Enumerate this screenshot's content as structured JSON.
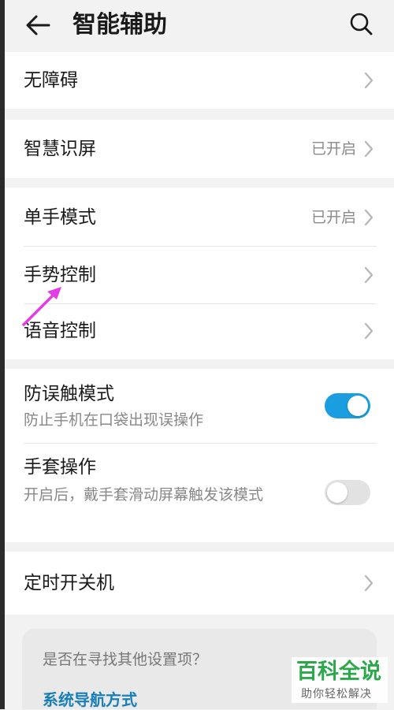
{
  "header": {
    "title": "智能辅助",
    "back_icon": "arrow-left-icon",
    "search_icon": "search-icon"
  },
  "items": {
    "accessibility": {
      "title": "无障碍"
    },
    "smart_screen": {
      "title": "智慧识屏",
      "status": "已开启"
    },
    "one_hand": {
      "title": "单手模式",
      "status": "已开启"
    },
    "gesture": {
      "title": "手势控制"
    },
    "voice": {
      "title": "语音控制"
    },
    "anti_touch": {
      "title": "防误触模式",
      "subtitle": "防止手机在口袋出现误操作",
      "enabled": true
    },
    "glove": {
      "title": "手套操作",
      "subtitle": "开启后，戴手套滑动屏幕触发该模式",
      "enabled": false
    },
    "timer_power": {
      "title": "定时开关机"
    }
  },
  "suggestions": {
    "question": "是否在寻找其他设置项？",
    "link": "系统导航方式"
  },
  "watermark": {
    "main": "百科全说",
    "sub": "助你轻松解决"
  },
  "colors": {
    "toggle_on": "#1a9ee0",
    "toggle_off": "#e2e2e2",
    "link": "#1a7fb8",
    "annotation_arrow": "#e23ce6",
    "watermark": "#2aa84a"
  }
}
